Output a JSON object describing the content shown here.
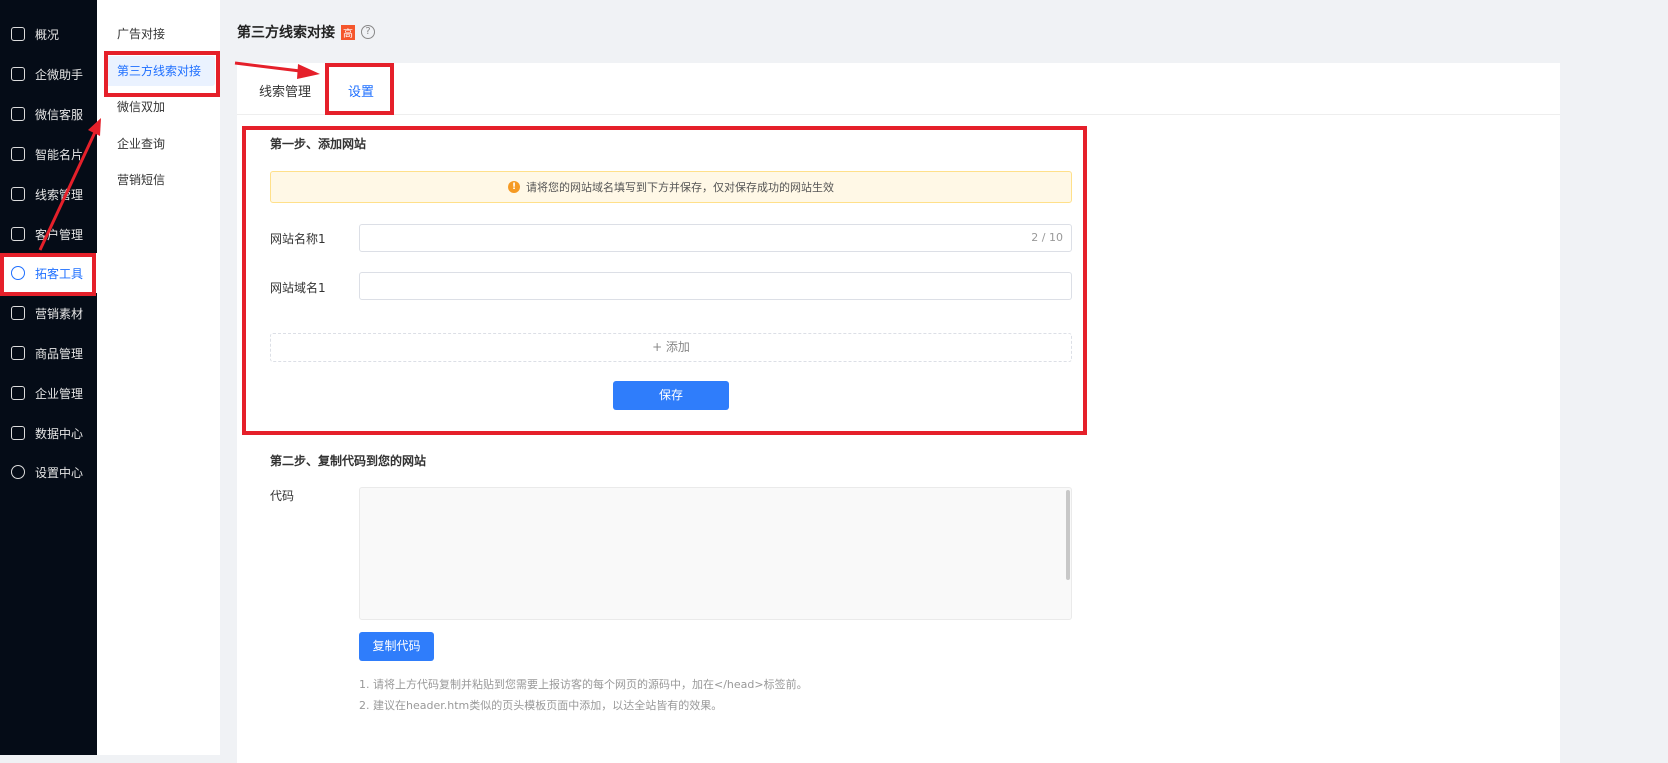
{
  "sidebar": {
    "items": [
      {
        "label": "概况"
      },
      {
        "label": "企微助手"
      },
      {
        "label": "微信客服"
      },
      {
        "label": "智能名片"
      },
      {
        "label": "线索管理"
      },
      {
        "label": "客户管理"
      },
      {
        "label": "拓客工具"
      },
      {
        "label": "营销素材"
      },
      {
        "label": "商品管理"
      },
      {
        "label": "企业管理"
      },
      {
        "label": "数据中心"
      },
      {
        "label": "设置中心"
      }
    ]
  },
  "submenu": {
    "items": [
      {
        "label": "广告对接"
      },
      {
        "label": "第三方线索对接"
      },
      {
        "label": "微信双加"
      },
      {
        "label": "企业查询"
      },
      {
        "label": "营销短信"
      }
    ]
  },
  "page": {
    "title": "第三方线索对接",
    "badge": "高",
    "help": "?"
  },
  "tabs": [
    {
      "label": "线索管理"
    },
    {
      "label": "设置"
    }
  ],
  "step1": {
    "heading": "第一步、添加网站",
    "alert": "请将您的网站域名填写到下方并保存，仅对保存成功的网站生效",
    "name_label": "网站名称1",
    "name_count": "2 / 10",
    "domain_label": "网站域名1",
    "add_label": "+ 添加",
    "save_label": "保存"
  },
  "step2": {
    "heading": "第二步、复制代码到您的网站",
    "code_label": "代码",
    "copy_label": "复制代码",
    "note1": "1. 请将上方代码复制并粘贴到您需要上报访客的每个网页的源码中，加在</head>标签前。",
    "note2": "2. 建议在header.htm类似的页头模板页面中添加，以达全站皆有的效果。"
  },
  "colors": {
    "accent": "#2f7dfb",
    "annotation": "#e5202a",
    "sidebar": "#050c17"
  }
}
